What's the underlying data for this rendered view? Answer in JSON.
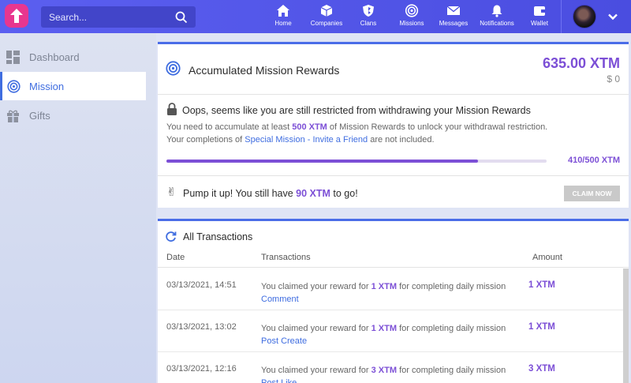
{
  "search": {
    "placeholder": "Search..."
  },
  "nav": [
    {
      "label": "Home",
      "icon": "home-icon"
    },
    {
      "label": "Companies",
      "icon": "cube-icon"
    },
    {
      "label": "Clans",
      "icon": "shield-icon"
    },
    {
      "label": "Missions",
      "icon": "target-icon"
    },
    {
      "label": "Messages",
      "icon": "envelope-icon"
    },
    {
      "label": "Notifications",
      "icon": "bell-icon"
    },
    {
      "label": "Wallet",
      "icon": "wallet-icon"
    }
  ],
  "sidebar": {
    "items": [
      {
        "label": "Dashboard",
        "icon": "dashboard-icon"
      },
      {
        "label": "Mission",
        "icon": "target-icon"
      },
      {
        "label": "Gifts",
        "icon": "gift-icon"
      }
    ],
    "active": "Mission"
  },
  "rewards": {
    "title": "Accumulated Mission Rewards",
    "amount": "635.00 XTM",
    "usd": "$ 0"
  },
  "restriction": {
    "title": "Oops, seems like you are still restricted from withdrawing your Mission Rewards",
    "line1_a": "You need to accumulate at least ",
    "line1_b": "500 XTM",
    "line1_c": " of Mission Rewards to unlock your withdrawal restriction.",
    "line2_a": "Your completions of ",
    "line2_b": "Special Mission - Invite a Friend",
    "line2_c": " are not included.",
    "progress_text": "410/500 XTM",
    "progress_fraction": 0.82
  },
  "pump": {
    "text_a": "Pump it up! You still have ",
    "text_b": "90 XTM",
    "text_c": " to go!",
    "claim_label": "CLAIM NOW"
  },
  "transactions": {
    "title": "All Transactions",
    "headers": {
      "date": "Date",
      "transactions": "Transactions",
      "amount": "Amount"
    },
    "rows": [
      {
        "date": "03/13/2021, 14:51",
        "pre": "You claimed your reward for ",
        "xtm": "1 XTM",
        "post": " for completing daily mission",
        "mission": "Comment",
        "amount": "1 XTM"
      },
      {
        "date": "03/13/2021, 13:02",
        "pre": "You claimed your reward for ",
        "xtm": "1 XTM",
        "post": " for completing daily mission",
        "mission": "Post Create",
        "amount": "1 XTM"
      },
      {
        "date": "03/13/2021, 12:16",
        "pre": "You claimed your reward for ",
        "xtm": "3 XTM",
        "post": " for completing daily mission",
        "mission": "Post Like",
        "amount": "3 XTM"
      }
    ]
  },
  "colors": {
    "accent": "#7c4fd6",
    "brand": "#4a4de0",
    "link": "#3f6de0"
  }
}
